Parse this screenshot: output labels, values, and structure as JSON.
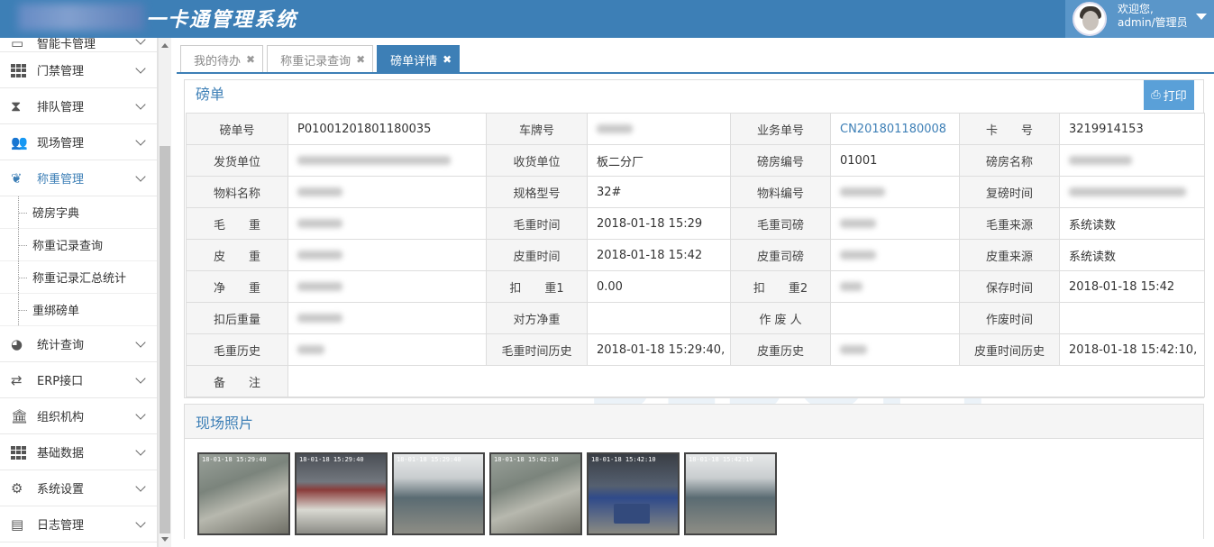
{
  "header": {
    "title": "一卡通管理系统",
    "welcome_line1": "欢迎您,",
    "welcome_line2": "admin/管理员"
  },
  "sidebar": {
    "items": [
      {
        "label": "智能卡管理",
        "icon": "card-icon"
      },
      {
        "label": "门禁管理",
        "icon": "grid-icon"
      },
      {
        "label": "排队管理",
        "icon": "hourglass-icon"
      },
      {
        "label": "现场管理",
        "icon": "users-icon"
      },
      {
        "label": "称重管理",
        "icon": "leaf-icon"
      },
      {
        "label": "统计查询",
        "icon": "pie-chart-icon"
      },
      {
        "label": "ERP接口",
        "icon": "exchange-icon"
      },
      {
        "label": "组织机构",
        "icon": "institution-icon"
      },
      {
        "label": "基础数据",
        "icon": "grid-icon"
      },
      {
        "label": "系统设置",
        "icon": "cogs-icon"
      },
      {
        "label": "日志管理",
        "icon": "file-icon"
      }
    ],
    "sub_items": [
      "磅房字典",
      "称重记录查询",
      "称重记录汇总统计",
      "重绑磅单"
    ]
  },
  "tabs": [
    {
      "label": "我的待办",
      "active": false
    },
    {
      "label": "称重记录查询",
      "active": false
    },
    {
      "label": "磅单详情",
      "active": true
    }
  ],
  "detail": {
    "title": "磅单",
    "print_label": "打印",
    "rows": [
      [
        {
          "l": "磅单号",
          "v": "P01001201801180035"
        },
        {
          "l": "车牌号",
          "v": "",
          "blur": 40
        },
        {
          "l": "业务单号",
          "v": "CN201801180008",
          "link": true
        },
        {
          "l": "卡　　号",
          "v": "3219914153"
        }
      ],
      [
        {
          "l": "发货单位",
          "v": "",
          "blur": 170
        },
        {
          "l": "收货单位",
          "v": "板二分厂"
        },
        {
          "l": "磅房编号",
          "v": "01001"
        },
        {
          "l": "磅房名称",
          "v": "",
          "blur": 70
        }
      ],
      [
        {
          "l": "物料名称",
          "v": "",
          "blur": 50
        },
        {
          "l": "规格型号",
          "v": "32#"
        },
        {
          "l": "物料编号",
          "v": "",
          "blur": 50
        },
        {
          "l": "复磅时间",
          "v": "",
          "blur": 130
        }
      ],
      [
        {
          "l": "毛　　重",
          "v": "",
          "blur": 50
        },
        {
          "l": "毛重时间",
          "v": "2018-01-18 15:29"
        },
        {
          "l": "毛重司磅",
          "v": "",
          "blur": 40
        },
        {
          "l": "毛重来源",
          "v": "系统读数"
        }
      ],
      [
        {
          "l": "皮　　重",
          "v": "",
          "blur": 50
        },
        {
          "l": "皮重时间",
          "v": "2018-01-18 15:42"
        },
        {
          "l": "皮重司磅",
          "v": "",
          "blur": 40
        },
        {
          "l": "皮重来源",
          "v": "系统读数"
        }
      ],
      [
        {
          "l": "净　　重",
          "v": "",
          "blur": 50
        },
        {
          "l": "扣　　重1",
          "v": "0.00"
        },
        {
          "l": "扣　　重2",
          "v": "",
          "blur": 25
        },
        {
          "l": "保存时间",
          "v": "2018-01-18 15:42"
        }
      ],
      [
        {
          "l": "扣后重量",
          "v": "",
          "blur": 50
        },
        {
          "l": "对方净重",
          "v": ""
        },
        {
          "l": "作 废 人",
          "v": ""
        },
        {
          "l": "作废时间",
          "v": ""
        }
      ],
      [
        {
          "l": "毛重历史",
          "v": "",
          "blur": 30
        },
        {
          "l": "毛重时间历史",
          "v": "2018-01-18 15:29:40,"
        },
        {
          "l": "皮重历史",
          "v": "",
          "blur": 30
        },
        {
          "l": "皮重时间历史",
          "v": "2018-01-18 15:42:10,"
        }
      ],
      [
        {
          "l": "备　　注",
          "v": "",
          "span": 7
        }
      ]
    ]
  },
  "photos": {
    "title": "现场照片",
    "items": [
      {
        "style": "ph-a",
        "stamp": "18-01-18 15:29:40"
      },
      {
        "style": "ph-b",
        "stamp": "18-01-18 15:29:40"
      },
      {
        "style": "ph-c",
        "stamp": "18-01-18 15:29:40"
      },
      {
        "style": "ph-a",
        "stamp": "18-01-18 15:42:10"
      },
      {
        "style": "ph-d",
        "stamp": "18-01-18 15:42:10"
      },
      {
        "style": "ph-c",
        "stamp": "18-01-18 15:42:10"
      }
    ]
  },
  "colors": {
    "primary": "#3d7fb6",
    "header_bg": "#3d7fb6",
    "print_button": "#5aa0d8",
    "label_bg": "#f5f5f5"
  }
}
